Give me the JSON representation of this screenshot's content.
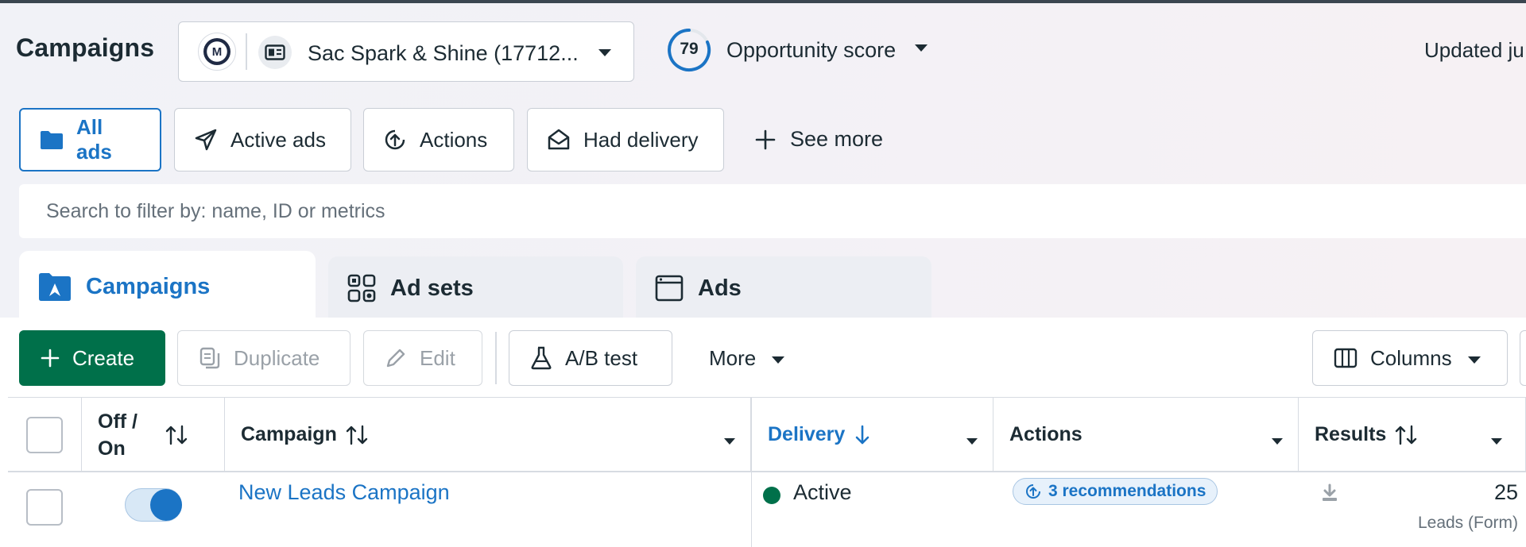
{
  "header": {
    "title": "Campaigns",
    "account_name": "Sac Spark & Shine (17712...",
    "account_logo_text": "M",
    "opportunity": {
      "score": "79",
      "label": "Opportunity score"
    },
    "updated_text": "Updated ju"
  },
  "filters": {
    "items": [
      {
        "label": "All ads",
        "icon": "folder-icon",
        "active": true
      },
      {
        "label": "Active ads",
        "icon": "paper-plane-icon",
        "active": false
      },
      {
        "label": "Actions",
        "icon": "arrow-up-circle-icon",
        "active": false
      },
      {
        "label": "Had delivery",
        "icon": "envelope-open-icon",
        "active": false
      }
    ],
    "see_more": "See more"
  },
  "search": {
    "placeholder": "Search to filter by: name, ID or metrics"
  },
  "level_tabs": [
    {
      "label": "Campaigns",
      "icon": "campaign-folder-icon",
      "selected": true
    },
    {
      "label": "Ad sets",
      "icon": "grid-icon",
      "selected": false
    },
    {
      "label": "Ads",
      "icon": "ad-window-icon",
      "selected": false
    }
  ],
  "toolbar": {
    "create": "Create",
    "duplicate": "Duplicate",
    "edit": "Edit",
    "ab_test": "A/B test",
    "more": "More",
    "columns": "Columns"
  },
  "table": {
    "columns": {
      "off_on_line1": "Off /",
      "off_on_line2": "On",
      "campaign": "Campaign",
      "delivery": "Delivery",
      "actions": "Actions",
      "results": "Results"
    },
    "rows": [
      {
        "toggle_on": true,
        "campaign": "New Leads Campaign",
        "delivery": "Active",
        "recommendations": "3 recommendations",
        "results_value": "25",
        "results_type": "Leads (Form)"
      }
    ]
  },
  "colors": {
    "accent_blue": "#1b74c5",
    "create_green": "#00704a",
    "status_active": "#00704a"
  }
}
